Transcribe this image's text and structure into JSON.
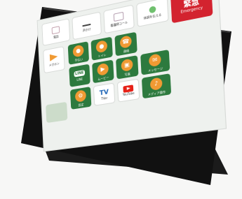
{
  "scene": {
    "background": "#f7f7f6",
    "frame_color": "#111111",
    "stand_color": "#1b1b1b"
  },
  "top_tiles": [
    {
      "label": "電話",
      "kind": "white"
    },
    {
      "label": "声かけ",
      "kind": "white"
    },
    {
      "label": "看護師コール",
      "kind": "white"
    },
    {
      "label": "体調を伝える",
      "kind": "white"
    },
    {
      "label": "緊急",
      "sub": "Emergency",
      "kind": "red"
    }
  ],
  "left_column": [
    {
      "label": "メガホン",
      "kind": "white"
    },
    {
      "label": "",
      "kind": "pale"
    }
  ],
  "apps": [
    {
      "label": "手伝い",
      "kind": "green"
    },
    {
      "label": "トイレ",
      "kind": "green"
    },
    {
      "label": "連絡",
      "kind": "green"
    },
    {
      "label": "LINE",
      "kind": "green"
    },
    {
      "label": "ムービー",
      "kind": "green"
    },
    {
      "label": "写真",
      "kind": "green"
    },
    {
      "label": "メッセージ",
      "kind": "green"
    },
    {
      "label": "設定",
      "kind": "green"
    },
    {
      "label": "TVer",
      "kind": "white"
    },
    {
      "label": "YouTube",
      "kind": "white"
    },
    {
      "label": "メディア操作",
      "kind": "green"
    }
  ],
  "colors": {
    "green": "#2d7a3e",
    "red": "#d3232f",
    "orange": "#f09a33"
  }
}
